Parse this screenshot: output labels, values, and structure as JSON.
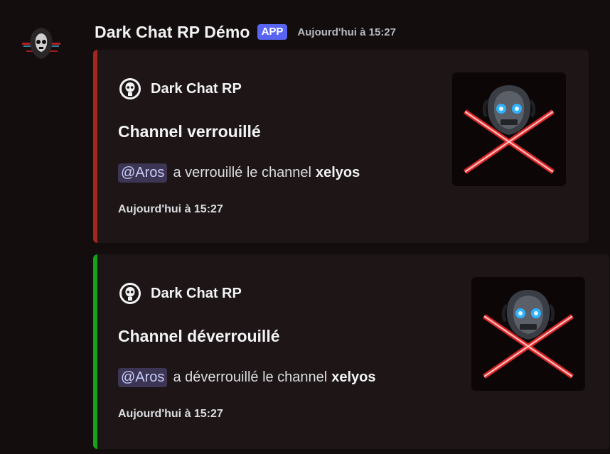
{
  "message": {
    "username": "Dark Chat RP Démo",
    "badge": "APP",
    "timestamp": "Aujourd'hui à 15:27"
  },
  "embeds": [
    {
      "author": "Dark Chat RP",
      "title": "Channel verrouillé",
      "mention": "@Aros",
      "action_text": "a verrouillé le channel",
      "channel": "xelyos",
      "footer": "Aujourd'hui à 15:27",
      "accent_color": "#a3261f"
    },
    {
      "author": "Dark Chat RP",
      "title": "Channel déverrouillé",
      "mention": "@Aros",
      "action_text": "a déverrouillé le channel",
      "channel": "xelyos",
      "footer": "Aujourd'hui à 15:27",
      "accent_color": "#17a01a"
    }
  ],
  "colors": {
    "app_badge": "#5865f2",
    "mention_bg": "#3c3553",
    "embed_bg": "#1d1516"
  }
}
